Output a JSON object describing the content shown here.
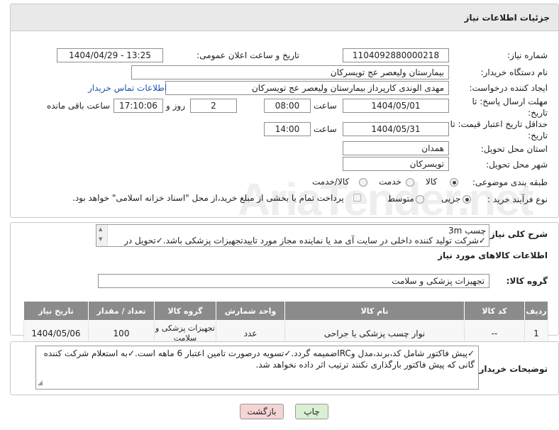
{
  "header": {
    "title": "جزئیات اطلاعات نیاز"
  },
  "watermark": {
    "text": "AriaTender.net"
  },
  "form": {
    "need_number": {
      "label": "شماره نیاز:",
      "value": "1104092880000218"
    },
    "announce_datetime": {
      "label": "تاریخ و ساعت اعلان عمومی:",
      "value": "1404/04/29 - 13:25"
    },
    "buyer_org": {
      "label": "نام دستگاه خریدار:",
      "value": "بیمارستان ولیعصر  عج  تویسرکان"
    },
    "requester": {
      "label": "ایجاد کننده درخواست:",
      "value": "مهدی الوندی کارپرداز بیمارستان ولیعصر  عج  تویسرکان",
      "contact_link": "اطلاعات تماس خریدار"
    },
    "reply_deadline": {
      "label": "مهلت ارسال پاسخ: تا تاریخ:",
      "date": "1404/05/01",
      "time_label": "ساعت",
      "time": "08:00",
      "days": "2",
      "days_label": "روز و",
      "remaining": "17:10:06",
      "remaining_label": "ساعت باقی مانده"
    },
    "price_validity": {
      "label": "حداقل تاریخ اعتبار قیمت: تا تاریخ:",
      "date": "1404/05/31",
      "time_label": "ساعت",
      "time": "14:00"
    },
    "delivery_province": {
      "label": "استان محل تحویل:",
      "value": "همدان"
    },
    "delivery_city": {
      "label": "شهر محل تحویل:",
      "value": "تویسرکان"
    },
    "category": {
      "label": "طبقه بندی موضوعی:",
      "options": [
        "کالا",
        "خدمت",
        "کالا/خدمت"
      ],
      "selected": "کالا"
    },
    "purchase_type": {
      "label": "نوع فرآیند خرید :",
      "options": [
        "جزیی",
        "متوسط"
      ],
      "selected": "جزیی",
      "payment_note": "پرداخت تمام یا بخشی از مبلغ خرید،از محل \"اسناد خزانه اسلامی\" خواهد بود."
    }
  },
  "description": {
    "label": "شرح کلی نیاز:",
    "line1": "چسب 3m",
    "line2": "✓شرکت تولید کننده داخلی در سایت آی مد یا نماینده مجاز مورد تاییدتجهیزات پزشکی باشد.✓تحویل در"
  },
  "goods_info": {
    "section_title": "اطلاعات کالاهای مورد نیاز",
    "group_label": "گروه کالا:",
    "group_value": "تجهیزات پزشکی و سلامت"
  },
  "table": {
    "headers": [
      "ردیف",
      "کد کالا",
      "نام کالا",
      "واحد شمارش",
      "گروه کالا",
      "تعداد / مقدار",
      "تاریخ نیاز"
    ],
    "rows": [
      {
        "row": "1",
        "code": "--",
        "name": "نوار چسب پزشکی یا جراحی",
        "unit": "عدد",
        "group": "تجهیزات پزشکی و سلامت",
        "qty": "100",
        "date": "1404/05/06"
      }
    ]
  },
  "buyer_notes": {
    "label": "توضیحات خریدار:",
    "text": "✓پیش فاکتور شامل کد،برند،مدل وIRCضمیمه گردد.✓تسویه درصورت تامین اعتبار 6 ماهه است.✓به استعلام شرکت کننده گانی که پیش فاکتور بارگذاری نکنند ترتیب اثر داده نخواهد شد."
  },
  "buttons": {
    "print": "چاپ",
    "back": "بازگشت"
  },
  "colors": {
    "link": "#1a55b0",
    "header_bg": "#e9e9e9",
    "table_header": "#8b8b8b",
    "back_bg": "#f4d4d4",
    "print_bg": "#d9f0d3"
  }
}
